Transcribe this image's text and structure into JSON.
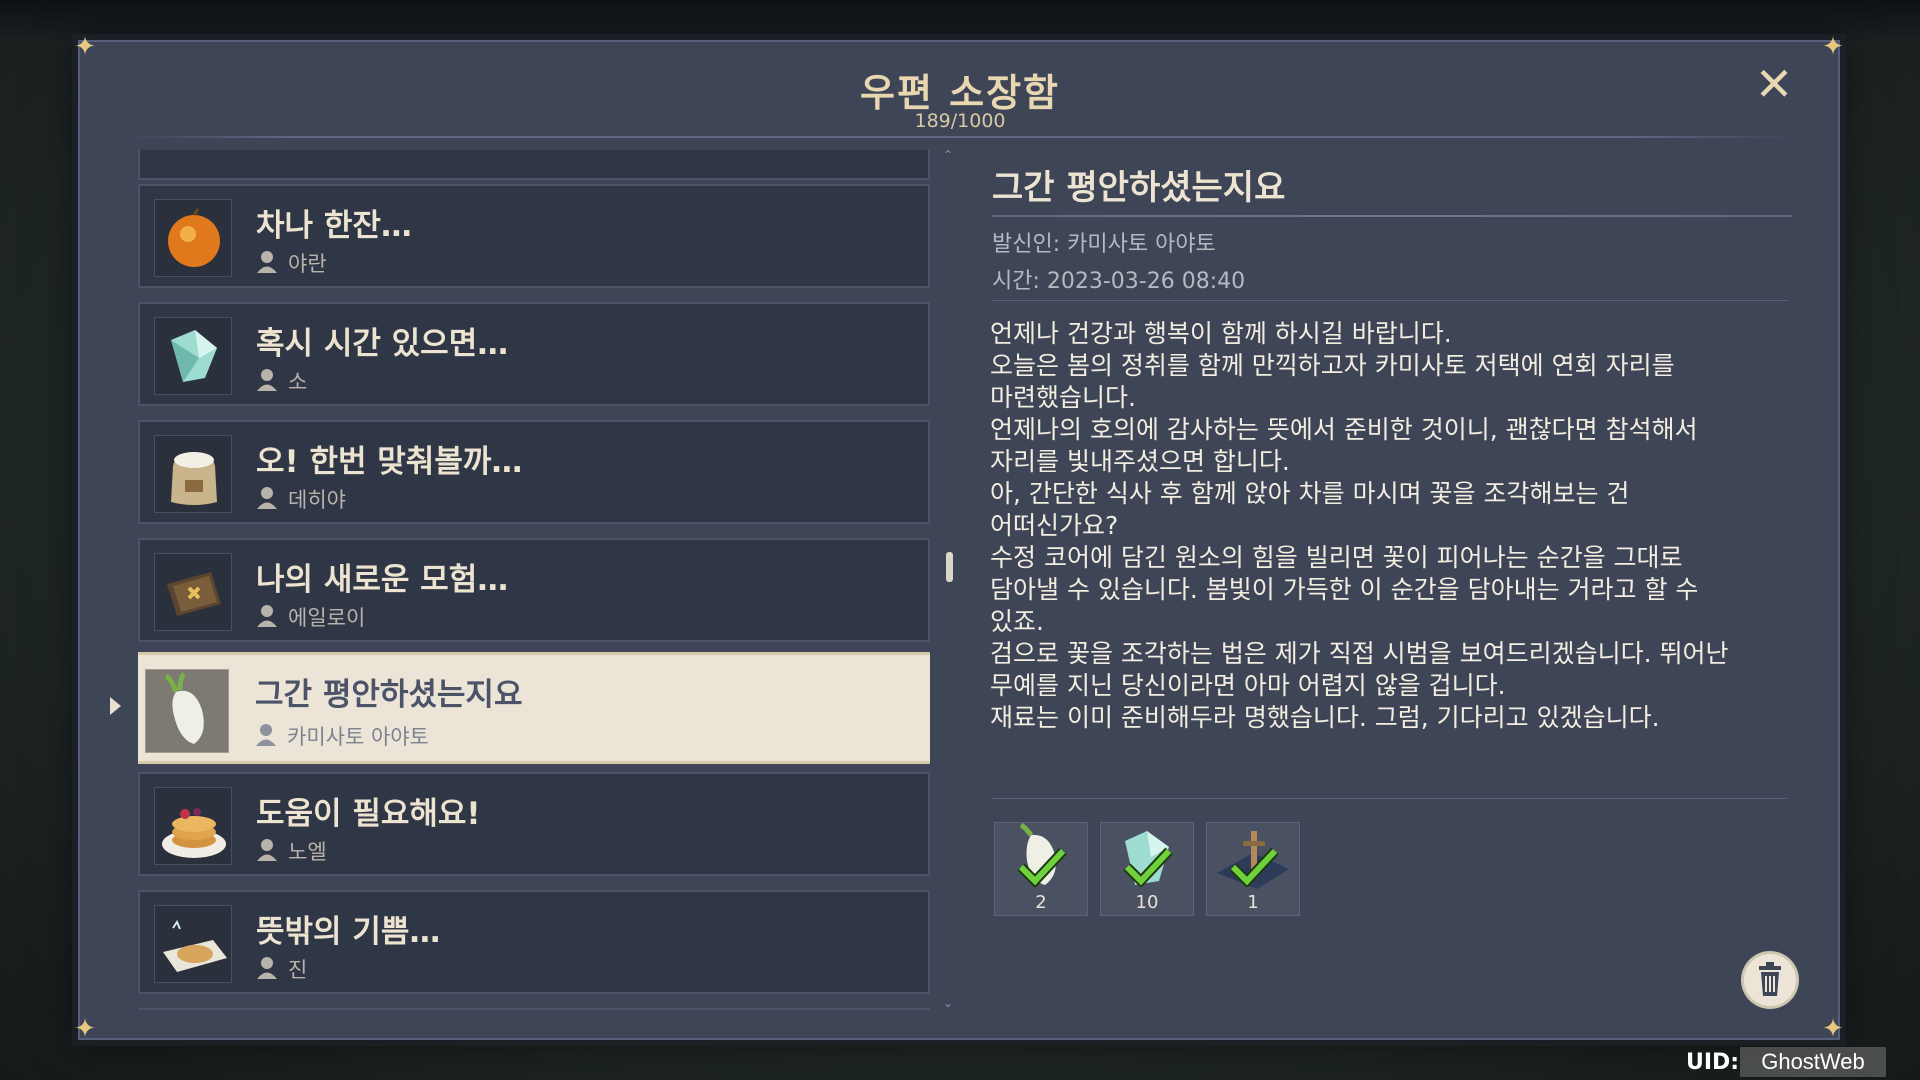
{
  "window": {
    "title": "우편 소장함",
    "counter": "189/1000",
    "close_icon": "close-icon"
  },
  "mail_list": [
    {
      "title": "차나 한잔…",
      "sender": "야란",
      "icon": "orange-fruit-icon",
      "selected": false
    },
    {
      "title": "혹시 시간 있으면…",
      "sender": "소",
      "icon": "crystal-icon",
      "selected": false
    },
    {
      "title": "오! 한번 맞춰볼까…",
      "sender": "데히야",
      "icon": "flour-sack-icon",
      "selected": false
    },
    {
      "title": "나의 새로운 모험…",
      "sender": "에일로이",
      "icon": "scroll-map-icon",
      "selected": false
    },
    {
      "title": "그간 평안하셨는지요",
      "sender": "카미사토 아야토",
      "icon": "radish-icon",
      "selected": true
    },
    {
      "title": "도움이 필요해요!",
      "sender": "노엘",
      "icon": "pancake-icon",
      "selected": false
    },
    {
      "title": "뜻밖의 기쁨…",
      "sender": "진",
      "icon": "pie-icon",
      "selected": false
    }
  ],
  "detail": {
    "title": "그간 평안하셨는지요",
    "sender_line": "발신인: 카미사토 아야토",
    "time_line": "시간: 2023-03-26 08:40",
    "body": "언제나 건강과 행복이 함께 하시길 바랍니다.\n오늘은 봄의 정취를 함께 만끽하고자 카미사토 저택에 연회 자리를\n마련했습니다.\n언제나의 호의에 감사하는 뜻에서 준비한 것이니, 괜찮다면 참석해서\n자리를 빛내주셨으면 합니다.\n아, 간단한 식사 후 함께 앉아 차를 마시며 꽃을 조각해보는 건\n어떠신가요?\n수정 코어에 담긴 원소의 힘을 빌리면 꽃이 피어나는 순간을 그대로\n담아낼 수 있습니다. 봄빛이 가득한 이 순간을 담아내는 거라고 할 수\n있죠.\n검으로 꽃을 조각하는 법은 제가 직접 시범을 보여드리겠습니다. 뛰어난\n무예를 지닌 당신이라면 아마 어렵지 않을 겁니다.\n재료는 이미 준비해두라 명했습니다. 그럼, 기다리고 있겠습니다.",
    "attachments": [
      {
        "icon": "radish-icon",
        "qty": "2",
        "claimed": true
      },
      {
        "icon": "crystal-core-icon",
        "qty": "10",
        "claimed": true
      },
      {
        "icon": "sword-stone-icon",
        "qty": "1",
        "claimed": true
      }
    ],
    "delete_icon": "trash-icon"
  },
  "footer": {
    "uid_label": "UID:",
    "uid_value": "GhostWeb"
  },
  "colors": {
    "panel": "#3d4557",
    "item": "#2f3645",
    "selected_item": "#ece5d7",
    "title_gold": "#e8d7b0",
    "check_green": "#6fd13b"
  }
}
